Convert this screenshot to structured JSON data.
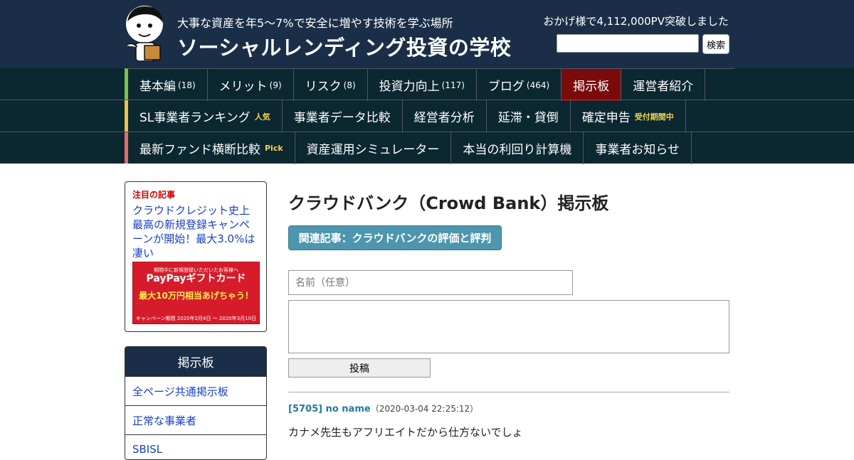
{
  "header": {
    "tagline": "大事な資産を年5～7%で安全に増やす技術を学ぶ場所",
    "site_title": "ソーシャルレンディング投資の学校",
    "pv_text": "おかげ様で4,112,000PV突破しました",
    "search_placeholder": "",
    "search_button": "検索",
    "bg_color": "#1a2f47"
  },
  "nav": {
    "row1": [
      {
        "label": "基本編",
        "count": "(18)"
      },
      {
        "label": "メリット",
        "count": "(9)"
      },
      {
        "label": "リスク",
        "count": "(8)"
      },
      {
        "label": "投資力向上",
        "count": "(117)"
      },
      {
        "label": "ブログ",
        "count": "(464)"
      },
      {
        "label": "掲示板",
        "count": "",
        "active": true
      },
      {
        "label": "運営者紹介",
        "count": ""
      }
    ],
    "row2": [
      {
        "label": "SL事業者ランキング",
        "tag": "人気"
      },
      {
        "label": "事業者データ比較",
        "tag": ""
      },
      {
        "label": "経営者分析",
        "tag": ""
      },
      {
        "label": "延滞・貸倒",
        "tag": ""
      },
      {
        "label": "確定申告",
        "tag": "受付期間中"
      }
    ],
    "row3": [
      {
        "label": "最新ファンド横断比較",
        "tag": "Pick"
      },
      {
        "label": "資産運用シミュレーター",
        "tag": ""
      },
      {
        "label": "本当の利回り計算機",
        "tag": ""
      },
      {
        "label": "事業者お知らせ",
        "tag": ""
      }
    ],
    "active_color": "#7a0b0b"
  },
  "sidebar": {
    "featured_label": "注目の記事",
    "featured_link": "クラウドクレジット史上最高の新規登録キャンペーンが開始！最大3.0%は凄い",
    "banner": {
      "line1": "期間中に新規登録いただいたお客様へ",
      "line2": "PayPayギフトカード",
      "line3": "最大10万円相当あげちゃう！",
      "line4": "キャンペーン期間 2020年2月4日 ～ 2020年3月10日"
    },
    "panel_title": "掲示板",
    "panel_items": [
      "全ページ共通掲示板",
      "正常な事業者",
      "SBISL"
    ]
  },
  "main": {
    "title": "クラウドバンク（Crowd Bank）掲示板",
    "related_button": "関連記事：クラウドバンクの評価と評判",
    "name_placeholder": "名前（任意）",
    "submit_label": "投稿",
    "posts": [
      {
        "author": "[5705] no name",
        "date": "（2020-03-04 22:25:12）",
        "body": "カナメ先生もアフリエイトだから仕方ないでしょ"
      }
    ]
  }
}
